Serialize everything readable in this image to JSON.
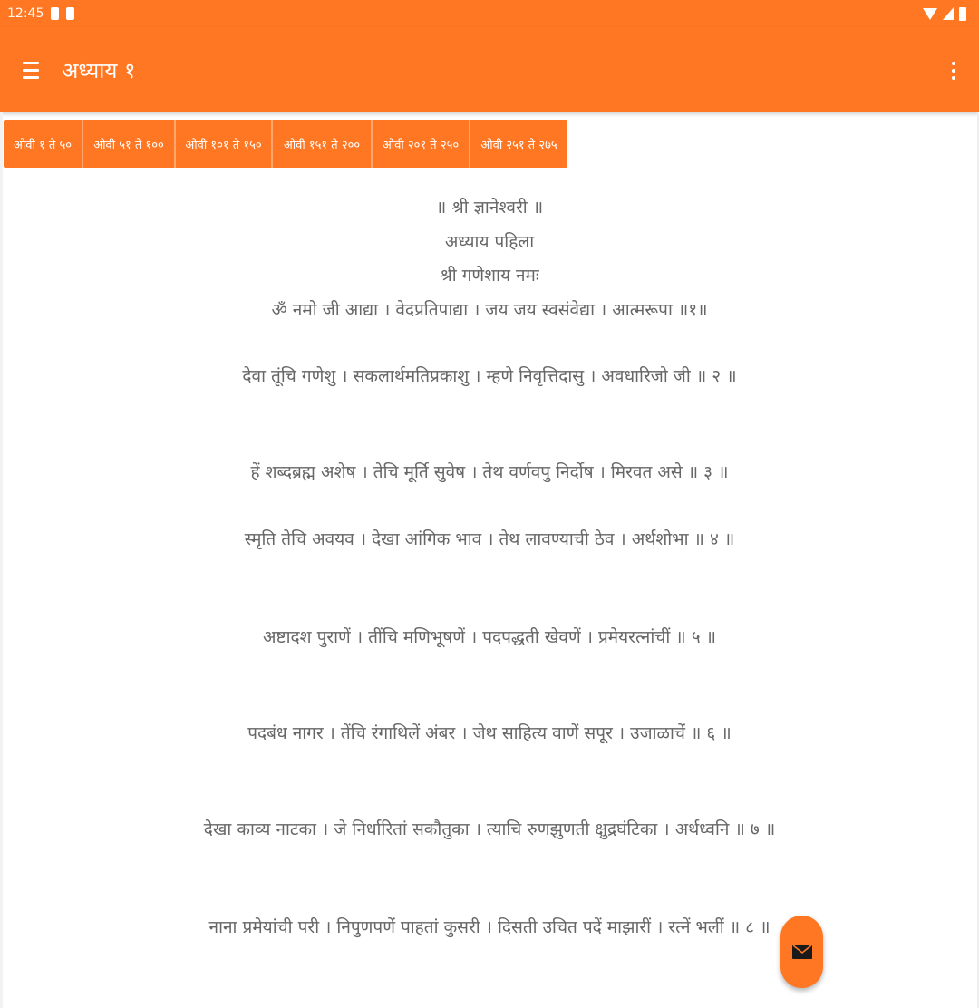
{
  "status_bar": {
    "time": "12:45"
  },
  "app_bar": {
    "title": "अध्याय १"
  },
  "tabs": [
    "ओवी १ ते ५०",
    "ओवी ५१ ते १००",
    "ओवी १०१ ते १५०",
    "ओवी १५१ ते २००",
    "ओवी २०१ ते २५०",
    "ओवी २५१ ते २७५"
  ],
  "content": {
    "heading_1": "॥ श्री ज्ञानेश्वरी ॥",
    "heading_2": "अध्याय पहिला",
    "heading_3": "श्री गणेशाय नमः",
    "verses": [
      "ॐ नमो जी आद्या । वेदप्रतिपाद्या । जय जय स्वसंवेद्या । आत्मरूपा ॥१॥",
      "देवा तूंचि गणेशु । सकलार्थमतिप्रकाशु । म्हणे निवृत्तिदासु । अवधारिजो जी ॥ २ ॥",
      "हें शब्दब्रह्म अशेष । तेचि मूर्ति सुवेष । तेथ वर्णवपु निर्दोष । मिरवत असे ॥ ३ ॥",
      "स्मृति तेचि अवयव । देखा आंगिक भाव । तेथ लावण्याची ठेव । अर्थशोभा ॥ ४ ॥",
      "अष्टादश पुराणें । तींचि मणिभूषणें । पदपद्धती खेवणें । प्रमेयरत्नांचीं ॥ ५ ॥",
      "पदबंध नागर । तेंचि रंगाथिलें अंबर । जेथ साहित्य वाणें सपूर । उजाळाचें ॥ ६ ॥",
      "देखा काव्य नाटका । जे निर्धारितां सकौतुका । त्याचि रुणझुणती क्षुद्रघंटिका । अर्थध्वनि ॥ ७ ॥",
      "नाना प्रमेयांची परी । निपुणपणें पाहतां कुसरी । दिसती उचित पदें माझारीं । रत्नें भलीं ॥ ८ ॥"
    ]
  },
  "fab": {
    "icon": "mail-icon"
  },
  "colors": {
    "primary": "#FF7722",
    "text": "#666666",
    "on_primary": "#FFFFFF"
  }
}
